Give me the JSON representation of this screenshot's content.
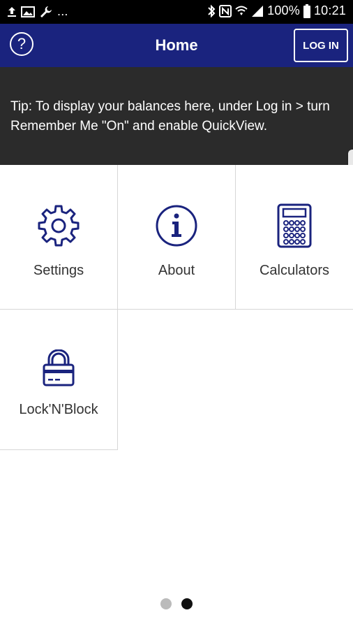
{
  "status_bar": {
    "overflow": "...",
    "battery": "100%",
    "time": "10:21"
  },
  "header": {
    "title": "Home",
    "help_icon": "?",
    "login_label": "LOG IN"
  },
  "tip": {
    "text": "Tip: To display your balances here, under Log in > turn Remember Me \"On\" and enable QuickView."
  },
  "tiles": [
    {
      "label": "Settings",
      "icon": "gear-icon"
    },
    {
      "label": "About",
      "icon": "info-icon"
    },
    {
      "label": "Calculators",
      "icon": "calculator-icon"
    },
    {
      "label": "Lock'N'Block",
      "icon": "lock-card-icon"
    }
  ],
  "pager": {
    "page_count": 2,
    "active_page": 2
  },
  "colors": {
    "header_bg": "#1a237e",
    "banner_bg": "#2b2b2b",
    "icon_navy": "#1a237e",
    "dot_active": "#111111",
    "dot_inactive": "#bbbbbb"
  }
}
